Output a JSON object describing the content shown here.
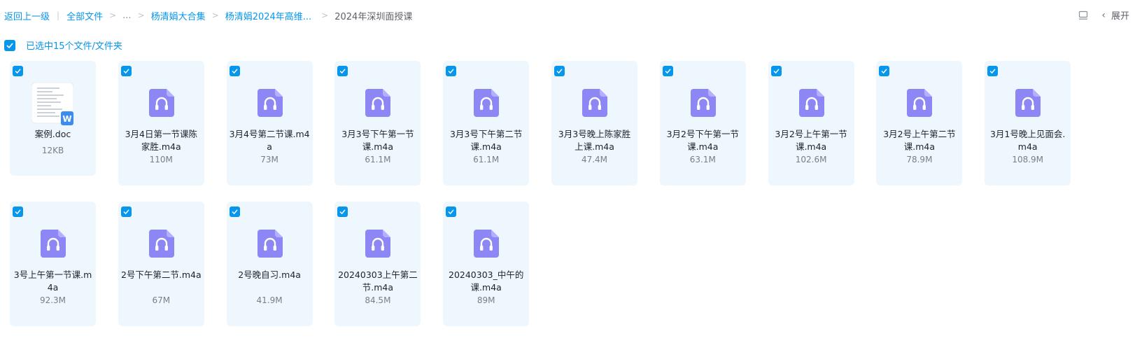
{
  "breadcrumb": {
    "back": "返回上一级",
    "all_files": "全部文件",
    "ellipsis": "...",
    "folder1": "杨清娟大合集",
    "folder2": "杨清娟2024年高维...",
    "current": "2024年深圳面授课"
  },
  "toolbar": {
    "expand_label": "展开"
  },
  "selection": {
    "label": "已选中15个文件/文件夹"
  },
  "colors": {
    "accent": "#0696ec",
    "card_bg": "#eef7fd",
    "audio_icon": "#8d86f5"
  },
  "files": [
    {
      "name": "案例.doc",
      "size": "12KB",
      "type": "doc",
      "icon": "word-doc-icon"
    },
    {
      "name": "3月4日第一节课陈家胜.m4a",
      "size": "110M",
      "type": "audio",
      "icon": "audio-file-icon"
    },
    {
      "name": "3月4号第二节课.m4a",
      "size": "73M",
      "type": "audio",
      "icon": "audio-file-icon"
    },
    {
      "name": "3月3号下午第一节课.m4a",
      "size": "61.1M",
      "type": "audio",
      "icon": "audio-file-icon"
    },
    {
      "name": "3月3号下午第二节课.m4a",
      "size": "61.1M",
      "type": "audio",
      "icon": "audio-file-icon"
    },
    {
      "name": "3月3号晚上陈家胜上课.m4a",
      "size": "47.4M",
      "type": "audio",
      "icon": "audio-file-icon"
    },
    {
      "name": "3月2号下午第一节课.m4a",
      "size": "63.1M",
      "type": "audio",
      "icon": "audio-file-icon"
    },
    {
      "name": "3月2号上午第一节课.m4a",
      "size": "102.6M",
      "type": "audio",
      "icon": "audio-file-icon"
    },
    {
      "name": "3月2号上午第二节课.m4a",
      "size": "78.9M",
      "type": "audio",
      "icon": "audio-file-icon"
    },
    {
      "name": "3月1号晚上见面会.m4a",
      "size": "108.9M",
      "type": "audio",
      "icon": "audio-file-icon"
    },
    {
      "name": "3号上午第一节课.m4a",
      "size": "92.3M",
      "type": "audio",
      "icon": "audio-file-icon"
    },
    {
      "name": "2号下午第二节.m4a",
      "size": "67M",
      "type": "audio",
      "icon": "audio-file-icon"
    },
    {
      "name": "2号晚自习.m4a",
      "size": "41.9M",
      "type": "audio",
      "icon": "audio-file-icon"
    },
    {
      "name": "20240303上午第二节.m4a",
      "size": "84.5M",
      "type": "audio",
      "icon": "audio-file-icon"
    },
    {
      "name": "20240303_中午的课.m4a",
      "size": "89M",
      "type": "audio",
      "icon": "audio-file-icon"
    }
  ]
}
